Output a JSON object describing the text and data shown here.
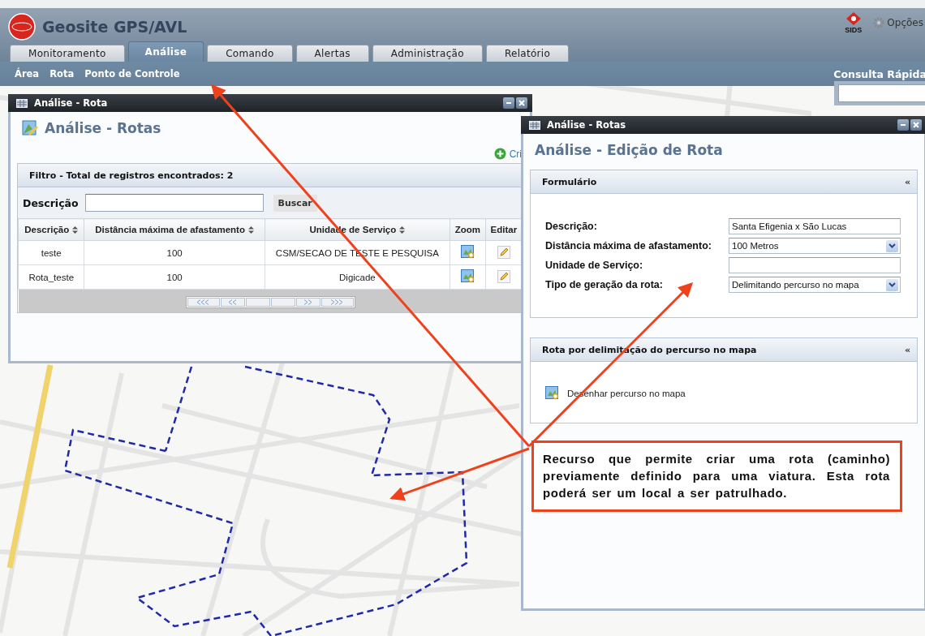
{
  "app": {
    "title": "Geosite GPS/AVL",
    "brand_badge": "SIDS",
    "options": "Opções"
  },
  "tabs": [
    {
      "label": "Monitoramento",
      "selected": false
    },
    {
      "label": "Análise",
      "selected": true
    },
    {
      "label": "Comando",
      "selected": false
    },
    {
      "label": "Alertas",
      "selected": false
    },
    {
      "label": "Administração",
      "selected": false
    },
    {
      "label": "Relatório",
      "selected": false
    }
  ],
  "subnav": [
    "Área",
    "Rota",
    "Ponto de Controle"
  ],
  "quick_search": {
    "title": "Consulta Rápida"
  },
  "list_window": {
    "title": "Análise - Rota",
    "heading": "Análise - Rotas",
    "create_link": "Cri",
    "filter": {
      "title": "Filtro - Total de registros encontrados: 2",
      "label": "Descrição",
      "button": "Buscar"
    },
    "table": {
      "columns": [
        {
          "label": "Descrição",
          "sortable": true
        },
        {
          "label": "Distância máxima de afastamento",
          "sortable": true
        },
        {
          "label": "Unidade de Serviço",
          "sortable": true
        },
        {
          "label": "Zoom",
          "sortable": false
        },
        {
          "label": "Editar",
          "sortable": false
        }
      ],
      "rows": [
        {
          "descricao": "teste",
          "distancia": "100",
          "unidade": "CSM/SECAO DE TESTE E PESQUISA"
        },
        {
          "descricao": "Rota_teste",
          "distancia": "100",
          "unidade": "Digicade"
        }
      ]
    }
  },
  "edit_window": {
    "title": "Análise - Rotas",
    "heading": "Análise - Edição de Rota",
    "form": {
      "title": "Formulário",
      "collapse": "«",
      "fields": [
        {
          "label": "Descrição:",
          "kind": "text",
          "value": "Santa Efigenia x São Lucas"
        },
        {
          "label": "Distância máxima de afastamento:",
          "kind": "select",
          "value": "100 Metros"
        },
        {
          "label": "Unidade de Serviço:",
          "kind": "text"
        },
        {
          "label": "Tipo de geração da rota:",
          "kind": "select",
          "value": "Delimitando percurso no mapa"
        }
      ]
    },
    "route_panel": {
      "title": "Rota por delimitação do percurso no mapa",
      "collapse": "«",
      "action": "Desenhar percurso no mapa"
    }
  },
  "callout": {
    "text": "Recurso que permite criar uma rota (caminho) previamente definido para uma viatura. Esta rota poderá ser um local a ser patrulhado."
  }
}
